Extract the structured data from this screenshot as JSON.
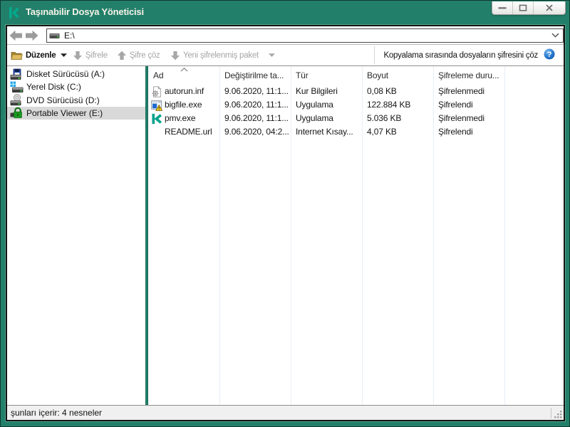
{
  "window": {
    "title": "Taşınabilir Dosya Yöneticisi",
    "controls": [
      {
        "name": "minimize"
      },
      {
        "name": "maximize"
      },
      {
        "name": "close"
      }
    ]
  },
  "colors": {
    "titlebar": "#22806a",
    "logo": "#00a88e",
    "selected_row": "#d9d9d9",
    "disabled_text": "#a5a5a5",
    "help_icon_blue": "#2a7fd4",
    "lock_green": "#179a1e",
    "folder_gold": "#c9a23a"
  },
  "navbar": {
    "back_icon": "back-arrow-icon",
    "forward_icon": "forward-arrow-icon",
    "address": "E:\\",
    "address_icon": "drive-icon",
    "dropdown_icon": "chevron-down-icon"
  },
  "toolbar": {
    "items": [
      {
        "label": "Düzenle",
        "icon": "folder-open-icon",
        "enabled": true,
        "has_dropdown": true
      },
      {
        "label": "Şifrele",
        "icon": "arrow-down-icon",
        "enabled": false,
        "has_dropdown": false
      },
      {
        "label": "Şifre çöz",
        "icon": "arrow-up-icon",
        "enabled": false,
        "has_dropdown": false
      },
      {
        "label": "Yeni şifrelenmiş paket",
        "icon": "arrow-down-icon",
        "enabled": false,
        "has_dropdown": true
      }
    ],
    "right_label": "Kopyalama sırasında dosyaların şifresini çöz",
    "help_icon": "help-icon"
  },
  "sidebar": {
    "items": [
      {
        "label": "Disket Sürücüsü (A:)",
        "icon": "floppy-drive-icon",
        "selected": false
      },
      {
        "label": "Yerel Disk (C:)",
        "icon": "local-disk-icon",
        "selected": false
      },
      {
        "label": "DVD Sürücüsü (D:)",
        "icon": "dvd-drive-icon",
        "selected": false
      },
      {
        "label": "Portable Viewer (E:)",
        "icon": "encrypted-drive-icon",
        "selected": true
      }
    ]
  },
  "filelist": {
    "columns": [
      "Ad",
      "Değiştirilme ta...",
      "Tür",
      "Boyut",
      "Şifreleme duru..."
    ],
    "sort_column_index": 0,
    "sort_icon": "sort-asc-icon",
    "rows": [
      {
        "icon": "setup-file-icon",
        "name": "autorun.inf",
        "modified": "9.06.2020, 11:1...",
        "type": "Kur Bilgileri",
        "size": "0,08 KB",
        "encryption": "Şifrelenmedi"
      },
      {
        "icon": "application-icon",
        "name": "bigfile.exe",
        "modified": "9.06.2020, 11:1...",
        "type": "Uygulama",
        "size": "122.884 KB",
        "encryption": "Şifrelendi"
      },
      {
        "icon": "kaspersky-icon",
        "name": "pmv.exe",
        "modified": "9.06.2020, 11:1...",
        "type": "Uygulama",
        "size": "5.036 KB",
        "encryption": "Şifrelenmedi"
      },
      {
        "icon": "none",
        "name": "README.url",
        "modified": "9.06.2020, 04:2...",
        "type": "Internet Kısay...",
        "size": "4,07 KB",
        "encryption": "Şifrelendi"
      }
    ]
  },
  "statusbar": {
    "text": "şunları içerir: 4 nesneler"
  }
}
